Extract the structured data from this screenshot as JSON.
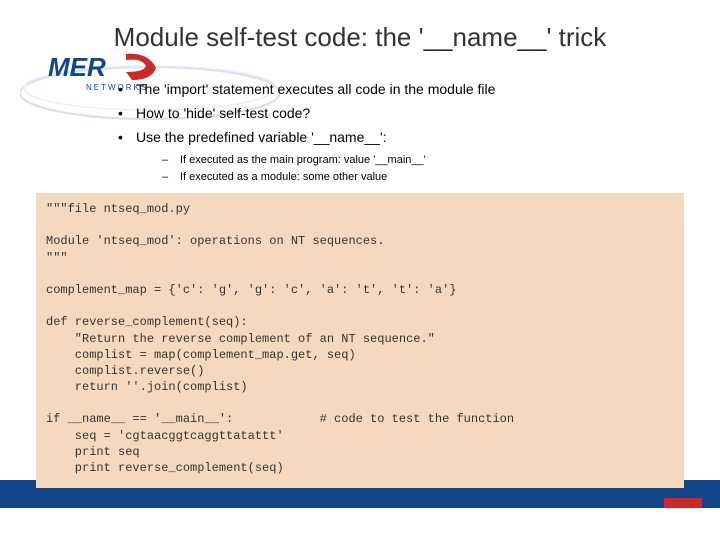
{
  "title": "Module self-test code: the '__name__' trick",
  "bullets": {
    "b1": "The 'import' statement executes all code in the module file",
    "b2": "How to 'hide' self-test code?",
    "b3": "Use the predefined variable '__name__':",
    "s1": "If executed as the main program: value '__main__'",
    "s2": "If executed as a module: some other value"
  },
  "code": "\"\"\"file ntseq_mod.py\n\nModule 'ntseq_mod': operations on NT sequences.\n\"\"\"\n\ncomplement_map = {'c': 'g', 'g': 'c', 'a': 't', 't': 'a'}\n\ndef reverse_complement(seq):\n    \"Return the reverse complement of an NT sequence.\"\n    complist = map(complement_map.get, seq)\n    complist.reverse()\n    return ''.join(complist)\n\nif __name__ == '__main__':            # code to test the function\n    seq = 'cgtaacggtcaggttatattt'\n    print seq\n    print reverse_complement(seq)",
  "logo": {
    "text1": "MER",
    "text2": "NETWORKS"
  }
}
